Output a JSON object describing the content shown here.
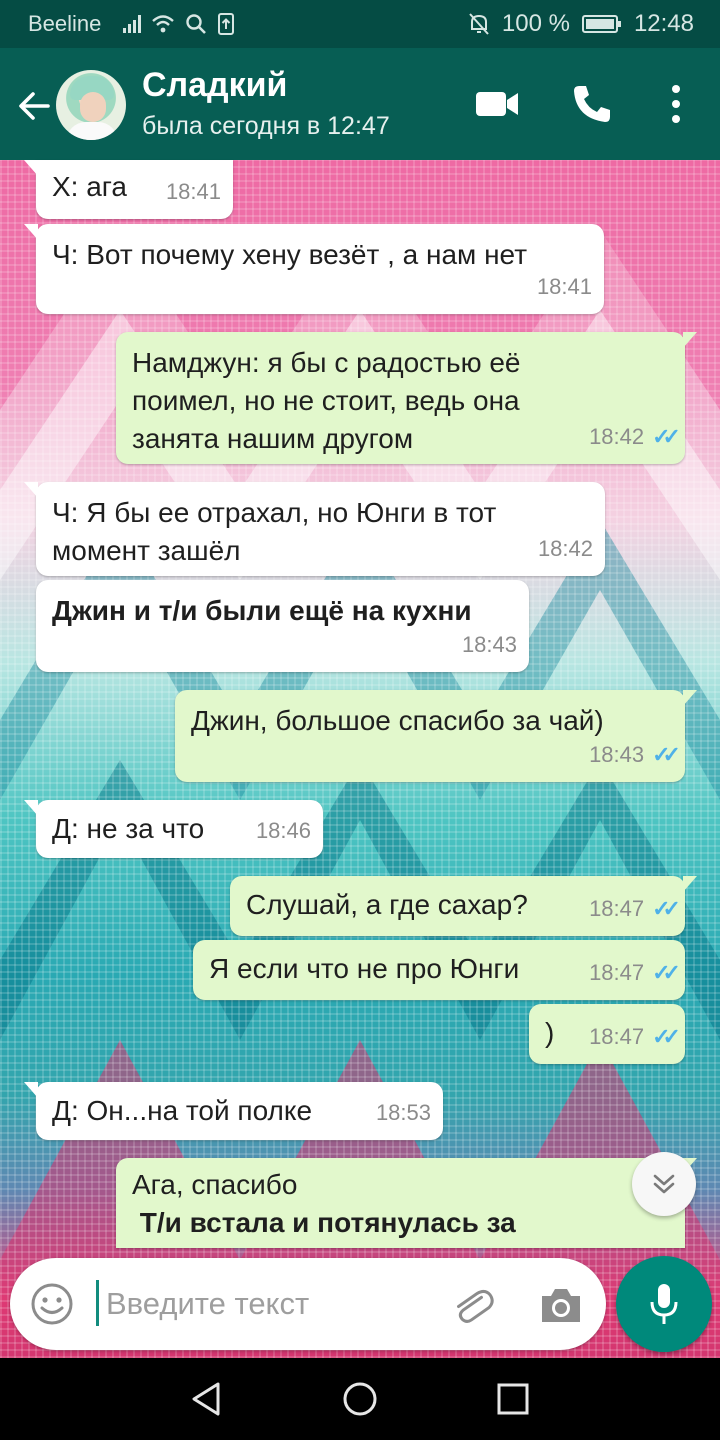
{
  "status_bar": {
    "carrier": "Beeline",
    "battery": "100 %",
    "time": "12:48"
  },
  "header": {
    "contact_name": "Сладкий",
    "last_seen": "была сегодня в 12:47"
  },
  "messages": [
    {
      "dir": "in",
      "lines": [
        "Х: ага"
      ],
      "time": "18:41"
    },
    {
      "dir": "in",
      "lines": [
        "Ч: Вот почему хену везёт , а нам нет"
      ],
      "time": "18:41"
    },
    {
      "dir": "out",
      "lines": [
        "Намджун: я бы с радостью её",
        "поимел, но не стоит, ведь она",
        "занята нашим другом"
      ],
      "time": "18:42",
      "read": true
    },
    {
      "dir": "in",
      "lines": [
        "Ч: Я бы ее отрахал, но Юнги в тот",
        "момент зашёл"
      ],
      "time": "18:42"
    },
    {
      "dir": "in",
      "lines": [
        "Джин и т/и были ещё на кухни"
      ],
      "time": "18:43",
      "bold": true
    },
    {
      "dir": "out",
      "lines": [
        "Джин, большое спасибо за чай)"
      ],
      "time": "18:43",
      "read": true
    },
    {
      "dir": "in",
      "lines": [
        "Д: не за что"
      ],
      "time": "18:46"
    },
    {
      "dir": "out",
      "lines": [
        "Слушай, а где сахар?"
      ],
      "time": "18:47",
      "read": true
    },
    {
      "dir": "out",
      "lines": [
        "Я если что не про Юнги"
      ],
      "time": "18:47",
      "read": true
    },
    {
      "dir": "out",
      "lines": [
        ")"
      ],
      "time": "18:47",
      "read": true
    },
    {
      "dir": "in",
      "lines": [
        "Д: Он...на той полке"
      ],
      "time": "18:53"
    },
    {
      "dir": "out",
      "lines": [
        "Ага, спасибо",
        " Т/и встала и потянулась за"
      ],
      "time": "",
      "read": false
    }
  ],
  "composer": {
    "placeholder": "Введите текст"
  },
  "colors": {
    "header": "#075e54",
    "status_bar": "#054c44",
    "outgoing_bubble": "#e2f8cc",
    "incoming_bubble": "#ffffff",
    "read_ticks": "#4fb1e8",
    "mic_button": "#00897b"
  }
}
